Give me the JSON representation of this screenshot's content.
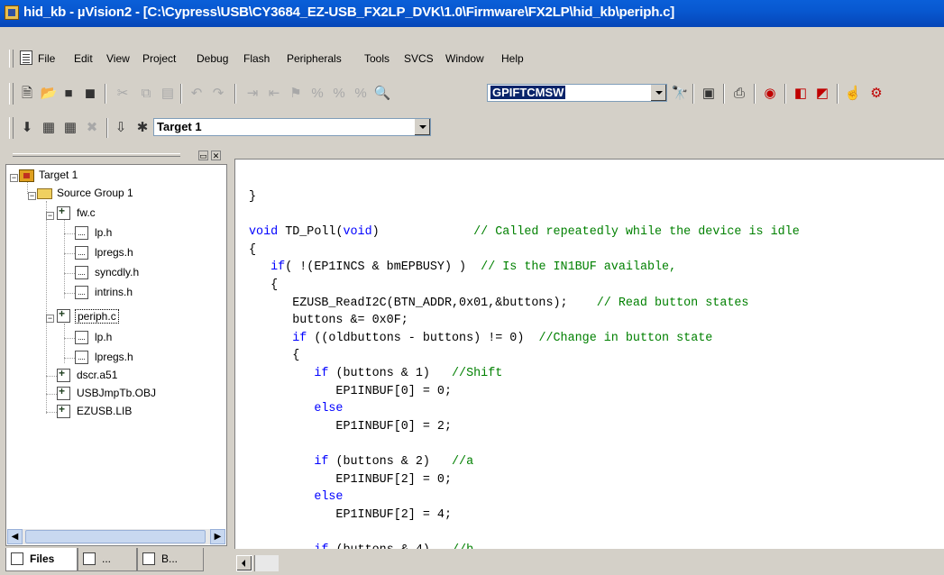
{
  "window": {
    "title": "hid_kb  - µVision2 - [C:\\Cypress\\USB\\CY3684_EZ-USB_FX2LP_DVK\\1.0\\Firmware\\FX2LP\\hid_kb\\periph.c]"
  },
  "menu": {
    "items": [
      "File",
      "Edit",
      "View",
      "Project",
      "Debug",
      "Flash",
      "Peripherals",
      "Tools",
      "SVCS",
      "Window",
      "Help"
    ]
  },
  "toolbar1": {
    "find_value": "GPIFTCMSW"
  },
  "toolbar2": {
    "target_value": "Target 1"
  },
  "project_tree": {
    "target": "Target 1",
    "group": "Source Group 1",
    "fw_c": "fw.c",
    "fw_children": [
      "lp.h",
      "lpregs.h",
      "syncdly.h",
      "intrins.h"
    ],
    "periph_c": "periph.c",
    "periph_children": [
      "lp.h",
      "lpregs.h"
    ],
    "others": [
      "dscr.a51",
      "USBJmpTb.OBJ",
      "EZUSB.LIB"
    ]
  },
  "panel_tabs": [
    "Files",
    "...",
    "B..."
  ],
  "editor": {
    "lines": [
      {
        "code": "}",
        "comment": ""
      },
      {
        "code": "",
        "comment": ""
      },
      {
        "code": "void TD_Poll(void)             ",
        "comment": "// Called repeatedly while the device is idle"
      },
      {
        "code": "{",
        "comment": ""
      },
      {
        "code": "   if( !(EP1INCS & bmEPBUSY) )  ",
        "comment": "// Is the IN1BUF available,"
      },
      {
        "code": "   {",
        "comment": ""
      },
      {
        "code": "      EZUSB_ReadI2C(BTN_ADDR,0x01,&buttons);    ",
        "comment": "// Read button states"
      },
      {
        "code": "      buttons &= 0x0F;",
        "comment": ""
      },
      {
        "code": "      if ((oldbuttons - buttons) != 0)  ",
        "comment": "//Change in button state"
      },
      {
        "code": "      {",
        "comment": ""
      },
      {
        "code": "         if (buttons & 1)   ",
        "comment": "//Shift"
      },
      {
        "code": "            EP1INBUF[0] = 0;",
        "comment": ""
      },
      {
        "code": "         else",
        "comment": ""
      },
      {
        "code": "            EP1INBUF[0] = 2;",
        "comment": ""
      },
      {
        "code": "",
        "comment": ""
      },
      {
        "code": "         if (buttons & 2)   ",
        "comment": "//a"
      },
      {
        "code": "            EP1INBUF[2] = 0;",
        "comment": ""
      },
      {
        "code": "         else",
        "comment": ""
      },
      {
        "code": "            EP1INBUF[2] = 4;",
        "comment": ""
      },
      {
        "code": "",
        "comment": ""
      },
      {
        "code": "         if (buttons & 4)   ",
        "comment": "//b"
      }
    ]
  }
}
